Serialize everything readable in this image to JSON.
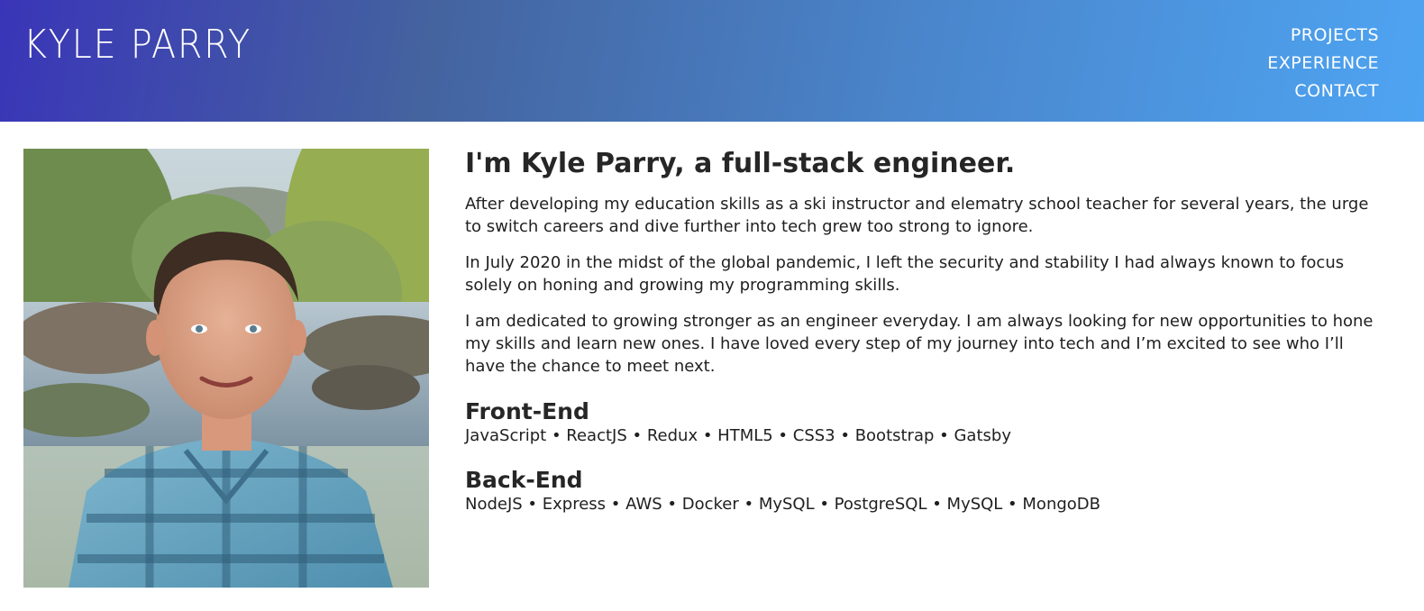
{
  "header": {
    "brand": "KYLE PARRY",
    "nav": [
      {
        "label": "PROJECTS"
      },
      {
        "label": "EXPERIENCE"
      },
      {
        "label": "CONTACT"
      }
    ]
  },
  "about": {
    "headline": "I'm Kyle Parry, a full-stack engineer.",
    "paragraphs": [
      "After developing my education skills as a ski instructor and elematry school teacher for several years, the urge to switch careers and dive further into tech grew too strong to ignore.",
      "In July 2020 in the midst of the global pandemic, I left the security and stability I had always known to focus solely on honing and growing my programming skills.",
      "I am dedicated to growing stronger as an engineer everyday. I am always looking for new opportunities to hone my skills and learn new ones. I have loved every step of my journey into tech and I’m excited to see who I’ll have the chance to meet next."
    ]
  },
  "skills": {
    "frontend": {
      "title": "Front-End",
      "list": "JavaScript • ReactJS • Redux • HTML5 • CSS3 • Bootstrap • Gatsby"
    },
    "backend": {
      "title": "Back-End",
      "list": "NodeJS • Express • AWS • Docker • MySQL • PostgreSQL • MySQL • MongoDB"
    }
  }
}
